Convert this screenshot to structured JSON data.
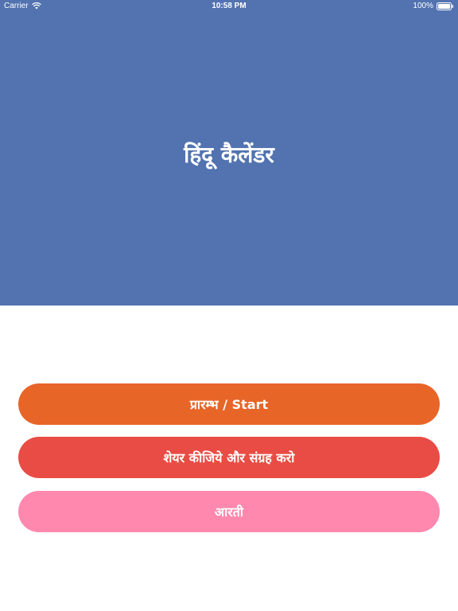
{
  "status_bar": {
    "carrier": "Carrier",
    "time": "10:58 PM",
    "battery_percent": "100%",
    "battery_level": 1.0,
    "icons": [
      "wifi-icon",
      "battery-icon"
    ]
  },
  "header": {
    "title": "हिंदू कैलेंडर",
    "background_color": "#5273B0"
  },
  "buttons": {
    "start_label": "प्रारम्भ / Start",
    "share_label": "शेयर कीजिये और संग्रह करो",
    "aarti_label": "आरती"
  },
  "colors": {
    "start": "#E86528",
    "share": "#E94C44",
    "aarti": "#FF88AF"
  }
}
